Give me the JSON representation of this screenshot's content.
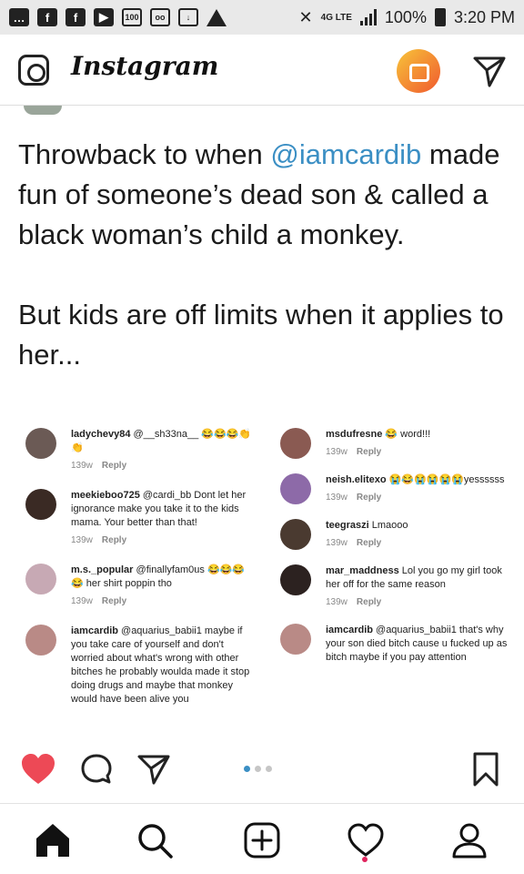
{
  "status_bar": {
    "left_icons": [
      "facebook-icon",
      "facebook-icon",
      "youtube-icon",
      "badge-100-icon",
      "voicemail-icon",
      "download-icon",
      "warning-icon"
    ],
    "badge_text": "100",
    "network": "4G LTE",
    "battery": "100%",
    "time": "3:20 PM"
  },
  "app": {
    "name": "Instagram",
    "accent": "#3b8fc4"
  },
  "post": {
    "caption_before_mention": "Throwback to when ",
    "mention": "@iamcardib",
    "caption_after_mention": " made fun of someone’s dead son & called a black woman’s child a monkey.",
    "caption_second": "But kids are off limits when it applies to her...",
    "carousel": {
      "total": 3,
      "current": 1
    }
  },
  "comments": {
    "left": [
      {
        "user": "ladychevy84",
        "text": " @__sh33na__ 😂😂😂👏👏",
        "time": "139w",
        "reply": "Reply"
      },
      {
        "user": "meekieboo725",
        "text": " @cardi_bb Dont let her ignorance make you take it to the kids mama. Your better than that!",
        "time": "139w",
        "reply": "Reply"
      },
      {
        "user": "m.s._popular",
        "text": " @finallyfam0us 😂😂😂 😂 her shirt poppin tho",
        "time": "139w",
        "reply": "Reply"
      },
      {
        "user": "iamcardib",
        "text": " @aquarius_babii1 maybe if you take care of yourself and don't worried about what's wrong with other bitches he probably woulda made it stop doing drugs and maybe that monkey would have been alive you",
        "time": "",
        "reply": ""
      }
    ],
    "right": [
      {
        "user": "msdufresne",
        "text": " 😂 word!!!",
        "time": "139w",
        "reply": "Reply"
      },
      {
        "user": "neish.elitexo",
        "text": " 😭😂😭😭😭😭yessssss",
        "time": "139w",
        "reply": "Reply"
      },
      {
        "user": "teegraszi",
        "text": " Lmaooo",
        "time": "139w",
        "reply": "Reply"
      },
      {
        "user": "mar_maddness",
        "text": " Lol you go my girl took her off for the same reason",
        "time": "139w",
        "reply": "Reply"
      },
      {
        "user": "iamcardib",
        "text": " @aquarius_babii1 that's why your son died bitch cause u fucked up as bitch maybe if you pay attention",
        "time": "",
        "reply": ""
      }
    ]
  },
  "actions": [
    "heart-icon",
    "comment-icon",
    "share-icon",
    "bookmark-icon"
  ],
  "bottom_nav": [
    "home-icon",
    "search-icon",
    "add-post-icon",
    "activity-icon",
    "profile-icon"
  ]
}
